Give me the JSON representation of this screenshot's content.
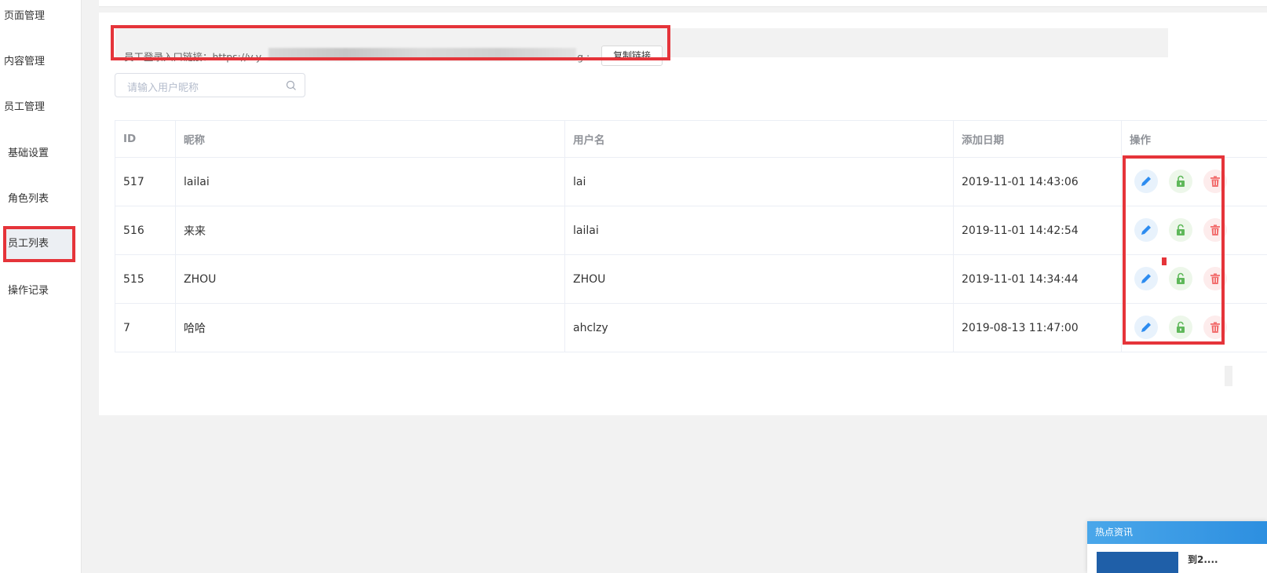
{
  "sidebar": {
    "items": [
      {
        "label": "页面管理",
        "level": "top"
      },
      {
        "label": "内容管理",
        "level": "top"
      },
      {
        "label": "员工管理",
        "level": "top"
      },
      {
        "label": "基础设置",
        "level": "sub"
      },
      {
        "label": "角色列表",
        "level": "sub"
      },
      {
        "label": "员工列表",
        "level": "sub",
        "active": true
      },
      {
        "label": "操作记录",
        "level": "sub"
      }
    ]
  },
  "link_bar": {
    "label": "员工登录入口链接：https://v.y",
    "trailing": "g :",
    "copy_button": "复制链接"
  },
  "search": {
    "placeholder": "请输入用户昵称",
    "icon": "search-icon"
  },
  "table": {
    "headers": [
      "ID",
      "昵称",
      "用户名",
      "添加日期",
      "操作"
    ],
    "rows": [
      {
        "id": "517",
        "nickname": "lailai",
        "username": "lai",
        "date": "2019-11-01 14:43:06"
      },
      {
        "id": "516",
        "nickname": "来来",
        "username": "lailai",
        "date": "2019-11-01 14:42:54"
      },
      {
        "id": "515",
        "nickname": "ZHOU",
        "username": "ZHOU",
        "date": "2019-11-01 14:34:44"
      },
      {
        "id": "7",
        "nickname": "哈哈",
        "username": "ahclzy",
        "date": "2019-08-13 11:47:00"
      }
    ],
    "actions": [
      "pencil-icon",
      "unlock-icon",
      "trash-icon"
    ]
  },
  "news": {
    "title": "热点资讯",
    "headline": "到2...."
  },
  "colors": {
    "highlight": "#e5343a",
    "edit": "#2d8cf0",
    "lock": "#5fb85a",
    "delete": "#f26e6e"
  }
}
